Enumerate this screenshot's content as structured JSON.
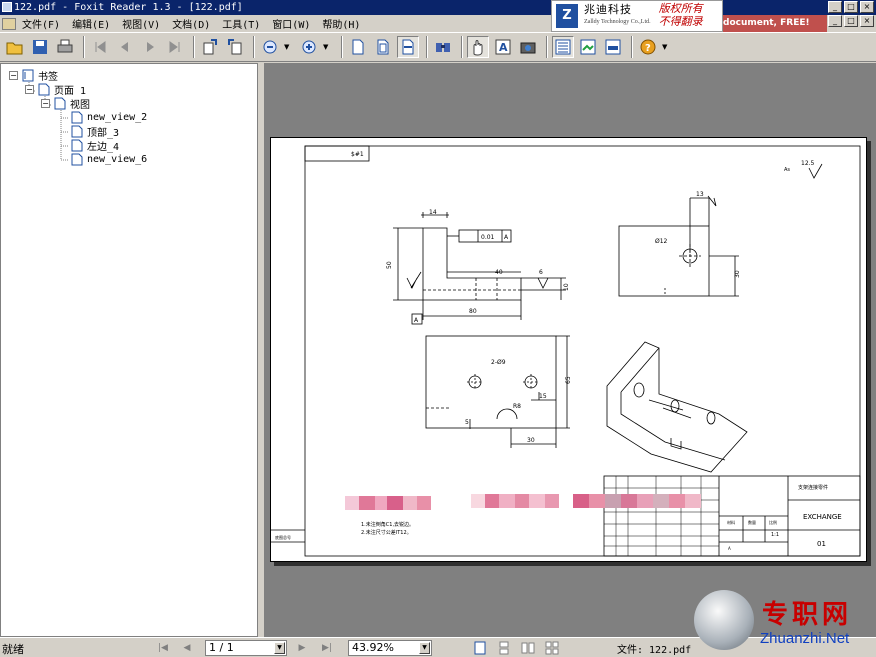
{
  "window": {
    "title": "122.pdf - Foxit Reader 1.3 - [122.pdf]"
  },
  "menu": [
    "文件(F)",
    "编辑(E)",
    "视图(V)",
    "文档(D)",
    "工具(T)",
    "窗口(W)",
    "帮助(H)"
  ],
  "ad": {
    "logo": "Z",
    "company_cn": "兆迪科技",
    "company_en": "Zalldy Technology Co.,Ltd.",
    "line1": "版权所有",
    "line2": "不得翻录",
    "tail": "document, FREE!"
  },
  "toolbar": {
    "icons": [
      "open-icon",
      "save-icon",
      "print-icon",
      "first-page-icon",
      "prev-page-icon",
      "next-page-icon",
      "last-page-icon",
      "rotate-left-icon",
      "rotate-right-icon",
      "zoom-out-icon",
      "zoom-in-icon",
      "actual-size-icon",
      "fit-page-icon",
      "fit-width-icon",
      "find-icon",
      "hand-tool-icon",
      "text-select-icon",
      "snapshot-icon",
      "bookmarks-panel-icon",
      "thumbnails-icon",
      "layers-icon",
      "help-icon"
    ]
  },
  "bookmarks": {
    "root": "书签",
    "page": "页面 1",
    "view": "视图",
    "children": [
      "new_view_2",
      "顶部_3",
      "左边_4",
      "new_view_6"
    ]
  },
  "drawing": {
    "corner_tag": "$#1",
    "roughness": "12.5",
    "dims": {
      "d14": "14",
      "d50": "50",
      "d40": "40",
      "d6": "6",
      "d10": "10",
      "d80": "80",
      "tol": "0.01",
      "datum": "A",
      "d12": "Ø12",
      "d13": "13",
      "d30": "30",
      "holes": "2-Ø9",
      "d65": "65",
      "d15": "15",
      "d5": "5",
      "d30b": "30",
      "r8": "R8"
    },
    "title_block": {
      "name": "支架连接零件",
      "code": "EXCHANGE",
      "num": "01",
      "scale": "1:1",
      "small_a": "A",
      "small_b": "比例",
      "small_c": "数量",
      "small_d": "材料"
    },
    "notes": [
      "1.未注倒角C1,去锐边。",
      "2.未注尺寸公差IT12。"
    ],
    "stamp": "底图总号"
  },
  "status": {
    "left": "就绪",
    "page": "1 / 1",
    "zoom": "43.92%",
    "file": "文件: 122.pdf"
  },
  "watermark": {
    "cn": "专职网",
    "en": "Zhuanzhi.Net"
  }
}
